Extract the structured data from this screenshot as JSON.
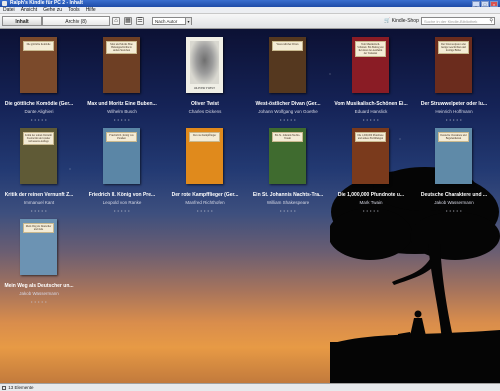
{
  "window": {
    "title": "Ralph's Kindle für PC 2 - Inhalt"
  },
  "menu": [
    "Datei",
    "Ansicht",
    "Gehe zu",
    "Tools",
    "Hilfe"
  ],
  "toolbar": {
    "tab_content": "Inhalt",
    "tab_archive": "Archiv (8)",
    "sort_value": "Nach Autor",
    "store_label": "Kindle-Shop",
    "search_placeholder": "Suche in der Kindle-Bibliothek"
  },
  "books": [
    {
      "title": "Die göttliche Komödie (Ger...",
      "author": "Dante Alighieri",
      "cover_text": "Die göttliche Komödie",
      "color": "#7b4a2b"
    },
    {
      "title": "Max und Moritz Eine Buben...",
      "author": "Wilhelm Busch",
      "cover_text": "Max und Moritz Eine Bubengeschichte in sieben Streichen",
      "color": "#6e3f24"
    },
    {
      "title": "Oliver Twist",
      "author": "Charles Dickens",
      "cover_text": "OLIVER TWIST",
      "color": "#e6e3d6",
      "style": "sketch"
    },
    {
      "title": "West-östlicher Divan (Ger...",
      "author": "Johann Wolfgang von Goethe",
      "cover_text": "West-östlicher Divan",
      "color": "#55381f"
    },
    {
      "title": "Vom Musikalisch-Schönen Ei...",
      "author": "Eduard Hanslick",
      "cover_text": "Vom Musikalisch-Schönen: Ein Beitrag zur Revision der Aesthetik der Tonkunst",
      "color": "#8a1c25"
    },
    {
      "title": "Der Struwwelpeter oder lu...",
      "author": "Heinrich Hoffmann",
      "cover_text": "Der Struwwelpeter oder lustige Geschichten und drollige Bilder",
      "color": "#6b2c1d"
    },
    {
      "title": "Kritik der reinen Vernunft Z...",
      "author": "Immanuel Kant",
      "cover_text": "Kritik der reinen Vernunft Zweite hin und wieder verbesserte Auflage",
      "color": "#5f5a36"
    },
    {
      "title": "Friedrich II. König von Pre...",
      "author": "Leopold von Ranke",
      "cover_text": "Friedrich II. König von Preußen",
      "color": "#5b86a6"
    },
    {
      "title": "Der rote Kampfflieger (Ger...",
      "author": "Manfred Richthofen",
      "cover_text": "Der rote Kampfflieger",
      "color": "#e08a1c"
    },
    {
      "title": "Ein St. Johannis Nachts-Tra...",
      "author": "William Shakespeare",
      "cover_text": "Ein St. Johannis Nachts-Traum",
      "color": "#3f6b2f"
    },
    {
      "title": "Die 1,000,000 Pfundnote u...",
      "author": "Mark Twain",
      "cover_text": "Die 1,000,000 Pfundnote und andere Erzählungen",
      "color": "#7a3a1c"
    },
    {
      "title": "Deutsche Charaktere und ...",
      "author": "Jakob Wassermann",
      "cover_text": "Deutsche Charaktere und Begebenheiten",
      "color": "#5f8aa8"
    },
    {
      "title": "Mein Weg als Deutscher un...",
      "author": "Jakob Wassermann",
      "cover_text": "Mein Weg als Deutscher und Jude",
      "color": "#6c93b3"
    }
  ],
  "rating_stars": "• • • • •",
  "status": {
    "count": "13 Elemente"
  }
}
